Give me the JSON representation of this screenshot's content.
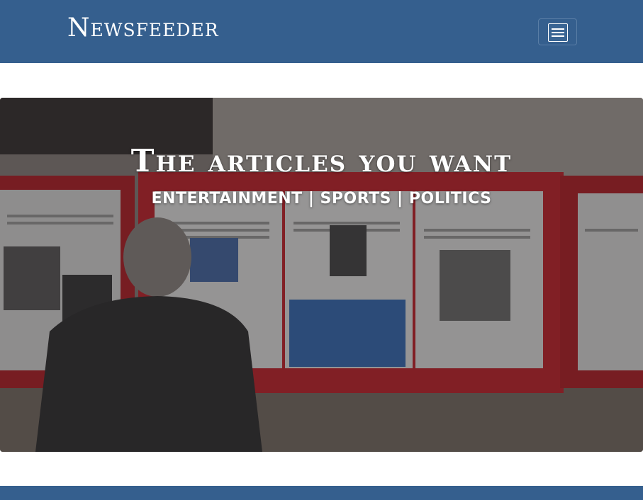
{
  "navbar": {
    "brand": "Newsfeeder",
    "menu_icon": "hamburger-menu-icon",
    "background_color": "#355f8e"
  },
  "hero": {
    "title": "The articles you want",
    "subtitle": "ENTERTAINMENT | SPORTS | POLITICS",
    "image": "man-reading-newspaper-board-photo",
    "accent_color": "#c8262a"
  },
  "footer": {
    "background_color": "#355f8e"
  }
}
